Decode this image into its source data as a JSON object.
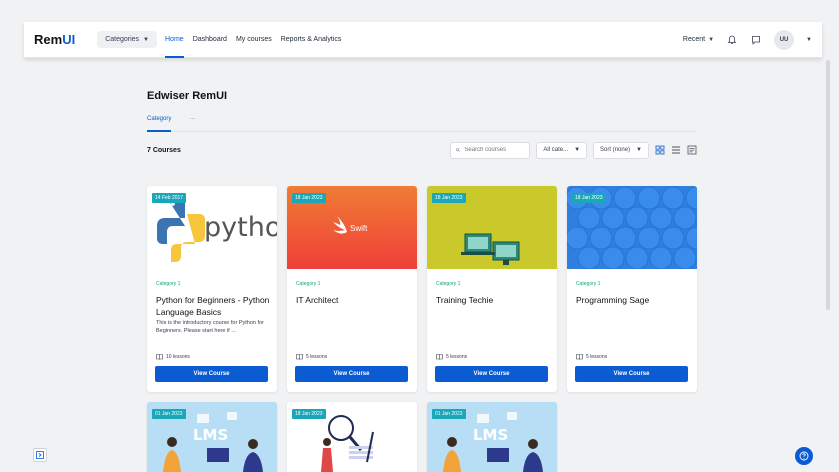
{
  "header": {
    "brand_main": "Rem",
    "brand_accent": "UI",
    "categories_label": "Categories",
    "nav": [
      "Home",
      "Dashboard",
      "My courses",
      "Reports & Analytics"
    ],
    "recent_label": "Recent",
    "avatar_initials": "UU"
  },
  "page": {
    "title": "Edwiser RemUI",
    "tabs": [
      "Category",
      "···"
    ]
  },
  "toolbar": {
    "count": "7 Courses",
    "search_placeholder": "Search courses",
    "category_filter": "All cate...",
    "sort": "Sort (none)"
  },
  "courses": [
    {
      "date": "14 Feb 2017",
      "category": "Category 1",
      "title": "Python for Beginners - Python Language Basics",
      "description": "This is the introductory course for Python for Beginners.  Please start here if ...",
      "lessons": "10 lessons",
      "button": "View Course",
      "image": "python-logo",
      "logo_text": "python"
    },
    {
      "date": "18 Jan 2023",
      "category": "Category 1",
      "title": "IT Architect",
      "description": "",
      "lessons": "5 lessons",
      "button": "View Course",
      "image": "swift-logo",
      "logo_text": "Swift"
    },
    {
      "date": "18 Jan 2023",
      "category": "Category 1",
      "title": "Training Techie",
      "description": "",
      "lessons": "5 lessons",
      "button": "View Course",
      "image": "computers-illustration"
    },
    {
      "date": "18 Jan 2023",
      "category": "Category 1",
      "title": "Programming Sage",
      "description": "",
      "lessons": "5 lessons",
      "button": "View Course",
      "image": "hexagon-pattern"
    },
    {
      "date": "01 Jan 2023",
      "image": "lms-illustration",
      "logo_text": "LMS"
    },
    {
      "date": "18 Jan 2023",
      "image": "magnifier-illustration"
    },
    {
      "date": "01 Jan 2023",
      "image": "lms-illustration",
      "logo_text": "LMS"
    }
  ],
  "colors": {
    "accent": "#0b5bd3",
    "date_badge": "#1aa8b8",
    "category": "#16a37a",
    "swift_top": "#f07c35",
    "swift_bottom": "#ef3f39",
    "techie_bg": "#c9c92c",
    "hex_bg": "#2f7fe0",
    "lms_bg": "#b8def5"
  }
}
